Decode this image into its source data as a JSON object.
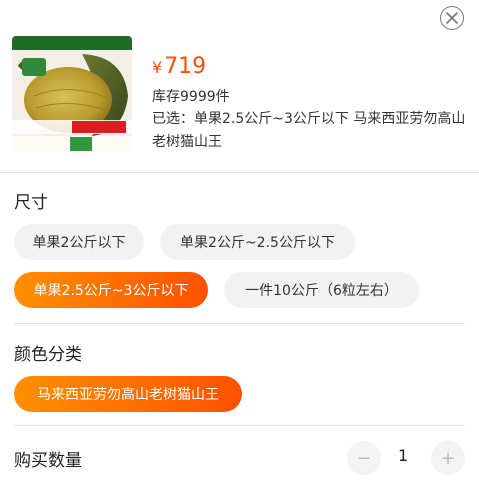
{
  "product": {
    "price_symbol": "¥",
    "price": "719",
    "stock": "库存9999件",
    "selected_text": "已选：单果2.5公斤~3公斤以下 马来西亚劳勿高山老树猫山王",
    "image_banner_top": "软糯香甜 口味醇香 新鲜猫王",
    "image_logo": "森海",
    "image_badge": "坏果包赔",
    "image_bottom": "马来西亚劳勿高山老树猫山王"
  },
  "size_section": {
    "title": "尺寸",
    "options": [
      "单果2公斤以下",
      "单果2公斤~2.5公斤以下",
      "单果2.5公斤~3公斤以下",
      "一件10公斤（6粒左右）"
    ],
    "selected_index": 2
  },
  "color_section": {
    "title": "颜色分类",
    "options": [
      "马来西亚劳勿高山老树猫山王"
    ],
    "selected_index": 0
  },
  "quantity": {
    "title": "购买数量",
    "value": "1",
    "minus": "−",
    "plus": "+"
  },
  "colors": {
    "accent_start": "#ff9000",
    "accent_end": "#ff5000",
    "chip_bg": "#f2f2f2"
  }
}
